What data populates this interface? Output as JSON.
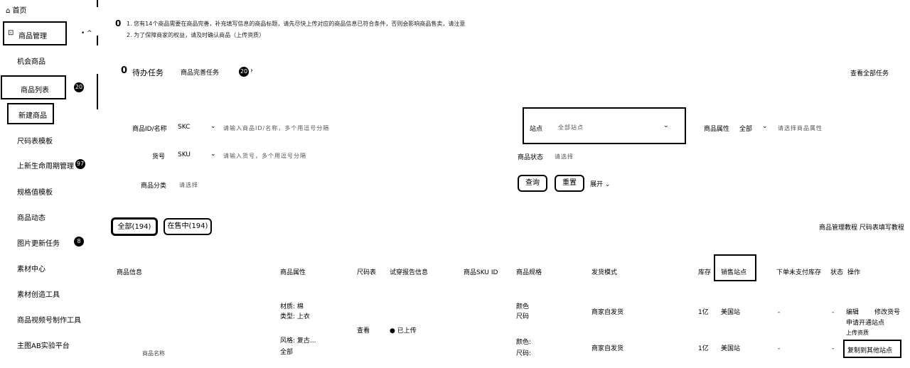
{
  "sidebar": {
    "home": "首页",
    "product_mgmt": "商品管理",
    "items": [
      {
        "label": "商品列表",
        "badge": "20"
      },
      {
        "label": "新建商品"
      },
      {
        "label": "尺码表模板"
      },
      {
        "label": "上新生命周期管理",
        "badge": "97"
      },
      {
        "label": "规格值模板"
      },
      {
        "label": "商品动态"
      },
      {
        "label": "图片更新任务",
        "badge": "8"
      },
      {
        "label": "素材中心"
      },
      {
        "label": "素材创造工具"
      },
      {
        "label": "商品视频号制作工具"
      },
      {
        "label": "主图AB实验平台"
      }
    ],
    "opportunity": "机会商品"
  },
  "notice": {
    "line1": "1. 您有14个商品需要在商品完善，补充填写信息的商品标题，请先尽快上传对应的商品信息已符合条件，否则会影响商品售卖，请注意",
    "line2": "2. 为了保障商家的权益，请及时确认商品（上传资质）"
  },
  "todo": {
    "title": "待办任务",
    "count": "0",
    "tab": "商品完善任务",
    "tab_count": "20",
    "view_all": "查看全部任务"
  },
  "filters": {
    "product_code_label": "商品ID/名称",
    "product_code_type": "SKC",
    "product_code_placeholder": "请输入商品ID/名称，多个用逗号分隔",
    "sku_label": "货号",
    "sku_type": "SKU",
    "sku_placeholder": "请输入货号，多个用逗号分隔",
    "category_label": "商品分类",
    "category_placeholder": "请选择",
    "site_label": "站点",
    "site_value": "全部站点",
    "attr_label": "商品属性",
    "attr_type": "全部",
    "attr_placeholder": "请选择商品属性",
    "status_label": "商品状态",
    "status_placeholder": "请选择",
    "query": "查询",
    "reset": "重置",
    "expand": "展开"
  },
  "tabs": [
    {
      "label": "全部(194)"
    },
    {
      "label": "在售中(194)"
    }
  ],
  "table_actions": "商品管理教程  尺码表填写教程",
  "columns": [
    "商品信息",
    "商品属性",
    "尺码表",
    "试穿报告信息",
    "商品SKU ID",
    "商品规格",
    "发货模式",
    "库存",
    "销售站点",
    "下单未支付库存",
    "状态",
    "操作"
  ],
  "rows": [
    {
      "attrs": [
        "材质: 棉",
        "类型: 上衣"
      ],
      "size_chart": "查看",
      "fit": "● 已上传",
      "spec": [
        "颜色",
        "尺码"
      ],
      "ship": "商家自发货",
      "stock": "1亿",
      "site": "美国站",
      "pending": "-",
      "status": "-",
      "ops": [
        "编辑",
        "修改货号",
        "申请开通站点",
        "上传资质"
      ]
    },
    {
      "info": "商品名称",
      "attrs": [
        "风格: 复古...",
        "全部"
      ],
      "spec": [
        "颜色:",
        "尺码:"
      ],
      "ship": "商家自发货",
      "stock": "1亿",
      "site": "美国站",
      "pending": "-",
      "status": "-",
      "ops": [
        "复制到其他站点"
      ]
    }
  ]
}
